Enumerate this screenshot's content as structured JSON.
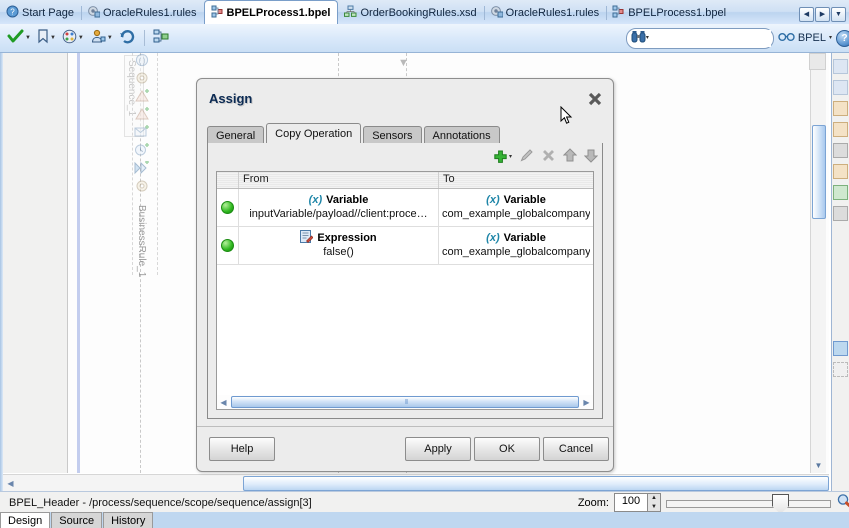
{
  "editor_tabs": [
    {
      "label": "Start Page",
      "icon": "help-circle-icon",
      "active": false
    },
    {
      "label": "OracleRules1.rules",
      "icon": "rules-icon",
      "active": false
    },
    {
      "label": "BPELProcess1.bpel",
      "icon": "bpel-icon",
      "active": true
    },
    {
      "label": "OrderBookingRules.xsd",
      "icon": "xsd-icon",
      "active": false
    },
    {
      "label": "OracleRules1.rules",
      "icon": "rules-icon",
      "active": false
    },
    {
      "label": "BPELProcess1.bpel",
      "icon": "bpel-icon",
      "active": false
    }
  ],
  "tab_nav": {
    "prev": "◀",
    "next": "▶",
    "list": "▼"
  },
  "toolbar": {
    "buttons": [
      {
        "name": "validate-button",
        "icon": "green-check-icon",
        "has_dropdown": true
      },
      {
        "name": "bookmark-button",
        "icon": "bookmark-icon",
        "has_dropdown": true
      },
      {
        "name": "palette-button",
        "icon": "color-palette-icon",
        "has_dropdown": true
      },
      {
        "name": "deploy-button",
        "icon": "deploy-icon",
        "has_dropdown": true
      },
      {
        "name": "refresh-button",
        "icon": "refresh-icon",
        "has_dropdown": false
      },
      {
        "name": "diagram-button",
        "icon": "diagram-icon",
        "has_dropdown": false
      }
    ],
    "search": {
      "value": "",
      "placeholder": "",
      "icon": "binoculars-icon",
      "dropdown_caret": "▾"
    },
    "mode_selector": {
      "label": "BPEL",
      "icon": "glasses-icon",
      "caret": "▾"
    },
    "help_label": "?"
  },
  "canvas": {
    "lane_labels": [
      "Sequence_1",
      "BusinessRule_1"
    ],
    "activity_icons": [
      "scope-icon",
      "gear-icon",
      "assign-icon",
      "assign-icon",
      "invoke-icon",
      "wait-icon",
      "transform-icon",
      "gear-icon"
    ]
  },
  "dialog": {
    "title": "Assign",
    "close_label": "✖",
    "tabs": [
      {
        "label": "General",
        "active": false
      },
      {
        "label": "Copy Operation",
        "active": true
      },
      {
        "label": "Sensors",
        "active": false
      },
      {
        "label": "Annotations",
        "active": false
      }
    ],
    "row_tools": [
      {
        "name": "add-button",
        "icon": "green-plus-icon",
        "enabled": true,
        "caret": "▾"
      },
      {
        "name": "edit-button",
        "icon": "pencil-icon",
        "enabled": false
      },
      {
        "name": "delete-button",
        "icon": "x-cross-icon",
        "enabled": false
      },
      {
        "name": "move-up-button",
        "icon": "arrow-up-icon",
        "enabled": true
      },
      {
        "name": "move-down-button",
        "icon": "arrow-down-icon",
        "enabled": true
      }
    ],
    "table": {
      "columns": [
        "",
        "From",
        "To"
      ],
      "rows": [
        {
          "status": "green-dot-icon",
          "from_type_icon": "(x)",
          "from_type": "Variable",
          "from_value": "inputVariable/payload//client:proce…",
          "to_type_icon": "(x)",
          "to_type": "Variable",
          "to_value": "com_example_globalcompany_ns_o"
        },
        {
          "status": "green-dot-icon",
          "from_type_icon": "expression-icon",
          "from_type": "Expression",
          "from_value": "false()",
          "to_type_icon": "(x)",
          "to_type": "Variable",
          "to_value": "com_example_globalcompany_ns_o"
        }
      ]
    },
    "buttons": {
      "help": "Help",
      "apply": "Apply",
      "ok": "OK",
      "cancel": "Cancel"
    }
  },
  "status_bar": {
    "text": "BPEL_Header - /process/sequence/scope/sequence/assign[3]",
    "zoom_label": "Zoom:",
    "zoom_value": "100",
    "spin_up": "▲",
    "spin_down": "▼",
    "magnifier_icon": "magnifier-icon"
  },
  "bottom_tabs": [
    {
      "label": "Design",
      "active": true
    },
    {
      "label": "Source",
      "active": false
    },
    {
      "label": "History",
      "active": false
    }
  ],
  "colors": {
    "accent_blue": "#2f6ea5",
    "title_blue": "#0b2a53",
    "status_green": "#2fb81f",
    "variable_teal": "#1f86a8"
  }
}
